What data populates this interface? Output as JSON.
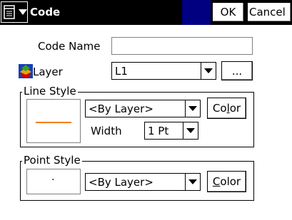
{
  "titlebar": {
    "title": "Code",
    "menu_icon": "start-menu-icon",
    "ok_label": "OK",
    "cancel_label": "Cancel"
  },
  "code_name": {
    "label": "Code Name",
    "value": ""
  },
  "layer": {
    "label": "Layer",
    "icon": "layer-icon",
    "value": "L1",
    "browse_label": "..."
  },
  "line_style": {
    "group_label": "Line Style",
    "style_value": "<By Layer>",
    "color_label_pre": "Co",
    "color_label_ul": "l",
    "color_label_post": "or",
    "width_label": "Width",
    "width_value": "1 Pt",
    "preview_color": "#f08000"
  },
  "point_style": {
    "group_label": "Point Style",
    "style_value": "<By Layer>",
    "color_label_pre": "",
    "color_label_ul": "C",
    "color_label_post": "olor",
    "preview_symbol": "·"
  },
  "colors": {
    "titlebar_bg": "#000000",
    "accent": "#000080"
  }
}
